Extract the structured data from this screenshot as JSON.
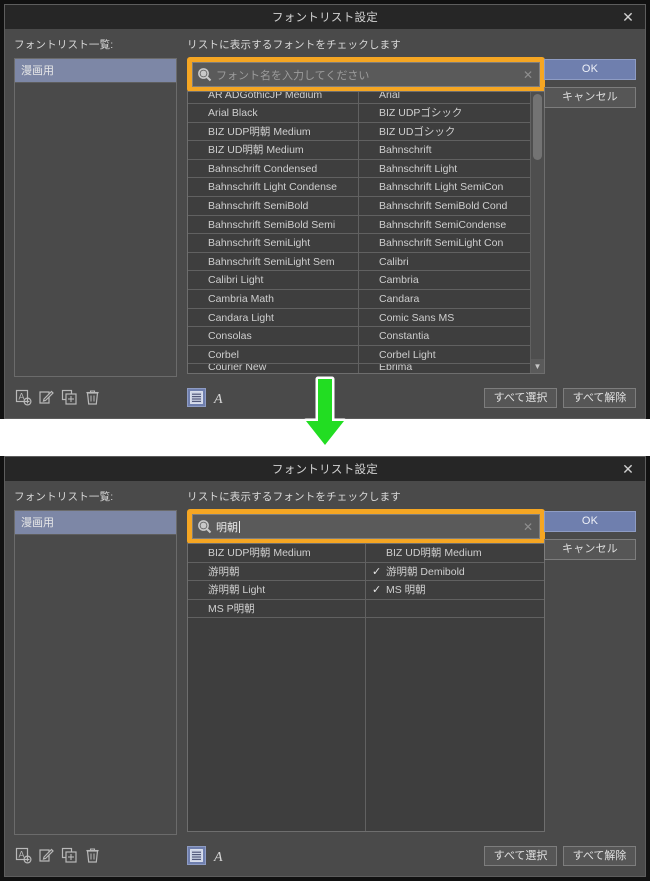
{
  "window": {
    "title": "フォントリスト設定",
    "close_icon": "close-icon"
  },
  "left_panel": {
    "label": "フォントリスト一覧:",
    "items": [
      "漫画用"
    ]
  },
  "center_panel": {
    "hint": "リストに表示するフォントをチェックします",
    "search_icon": "search-icon",
    "clear_icon": "clear-icon"
  },
  "buttons": {
    "ok": "OK",
    "cancel": "キャンセル",
    "select_all": "すべて選択",
    "deselect_all": "すべて解除"
  },
  "toolbar": {
    "add_list_icon": "add-font-list-icon",
    "rename_icon": "edit-pencil-icon",
    "duplicate_icon": "duplicate-icon",
    "delete_icon": "trash-icon",
    "list-view_icon": "list-view-icon",
    "sample-view_icon": "font-sample-view-icon"
  },
  "dialog_before": {
    "search_value": "",
    "search_placeholder": "フォント名を入力してください",
    "scroll_position": "top",
    "font_grid": {
      "left_column": [
        {
          "name": "AR ADGothicJP Medium",
          "checked": false,
          "clipped": true
        },
        {
          "name": "Arial Black",
          "checked": false
        },
        {
          "name": "BIZ UDP明朝 Medium",
          "checked": false
        },
        {
          "name": "BIZ UD明朝 Medium",
          "checked": false
        },
        {
          "name": "Bahnschrift Condensed",
          "checked": false
        },
        {
          "name": "Bahnschrift Light Condense",
          "checked": false
        },
        {
          "name": "Bahnschrift SemiBold",
          "checked": false
        },
        {
          "name": "Bahnschrift SemiBold Semi",
          "checked": false
        },
        {
          "name": "Bahnschrift SemiLight",
          "checked": false
        },
        {
          "name": "Bahnschrift SemiLight Sem",
          "checked": false
        },
        {
          "name": "Calibri Light",
          "checked": false
        },
        {
          "name": "Cambria Math",
          "checked": false
        },
        {
          "name": "Candara Light",
          "checked": false
        },
        {
          "name": "Consolas",
          "checked": false
        },
        {
          "name": "Corbel",
          "checked": false
        },
        {
          "name": "Courier New",
          "checked": false,
          "clipped": true
        }
      ],
      "right_column": [
        {
          "name": "Arial",
          "checked": false,
          "clipped": true
        },
        {
          "name": "BIZ UDPゴシック",
          "checked": false
        },
        {
          "name": "BIZ UDゴシック",
          "checked": false
        },
        {
          "name": "Bahnschrift",
          "checked": false
        },
        {
          "name": "Bahnschrift Light",
          "checked": false
        },
        {
          "name": "Bahnschrift Light SemiCon",
          "checked": false
        },
        {
          "name": "Bahnschrift SemiBold Cond",
          "checked": false
        },
        {
          "name": "Bahnschrift SemiCondense",
          "checked": false
        },
        {
          "name": "Bahnschrift SemiLight Con",
          "checked": false
        },
        {
          "name": "Calibri",
          "checked": false
        },
        {
          "name": "Cambria",
          "checked": false
        },
        {
          "name": "Candara",
          "checked": false
        },
        {
          "name": "Comic Sans MS",
          "checked": false
        },
        {
          "name": "Constantia",
          "checked": false
        },
        {
          "name": "Corbel Light",
          "checked": false
        },
        {
          "name": "Ebrima",
          "checked": false,
          "clipped": true
        }
      ]
    }
  },
  "dialog_after": {
    "search_value": "明朝",
    "search_placeholder": "フォント名を入力してください",
    "font_grid": {
      "left_column": [
        {
          "name": "BIZ UDP明朝 Medium",
          "checked": false
        },
        {
          "name": "游明朝",
          "checked": false
        },
        {
          "name": "游明朝 Light",
          "checked": false
        },
        {
          "name": "MS P明朝",
          "checked": false
        }
      ],
      "right_column": [
        {
          "name": "BIZ UD明朝 Medium",
          "checked": false
        },
        {
          "name": "游明朝 Demibold",
          "checked": true
        },
        {
          "name": "MS 明朝",
          "checked": true
        },
        {
          "name": "",
          "checked": false,
          "blank": true
        }
      ]
    }
  },
  "annotation": {
    "arrow_icon": "green-down-arrow",
    "arrow_color": "#22dd22",
    "highlight_color": "#f5a623"
  }
}
